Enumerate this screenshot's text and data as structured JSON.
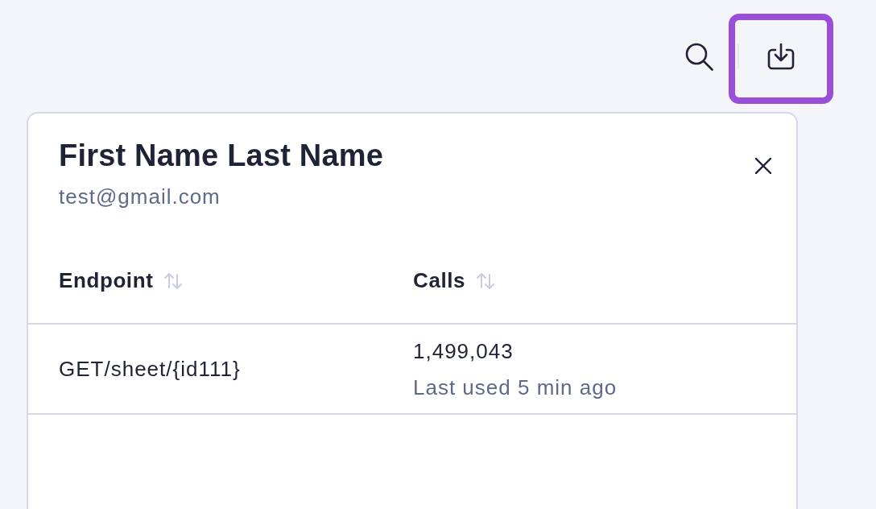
{
  "toolbar": {
    "buttons": [
      {
        "kind": "search",
        "highlighted": false
      },
      {
        "kind": "download",
        "highlighted": true
      }
    ]
  },
  "panel": {
    "title": "First Name Last Name",
    "subtitle": "test@gmail.com",
    "table": {
      "columns": [
        {
          "label": "Endpoint",
          "sortable": true
        },
        {
          "label": "Calls",
          "sortable": true
        }
      ],
      "rows": [
        {
          "endpoint": "GET/sheet/{id111}",
          "calls": "1,499,043",
          "last_used": "Last used 5 min ago"
        }
      ]
    }
  }
}
